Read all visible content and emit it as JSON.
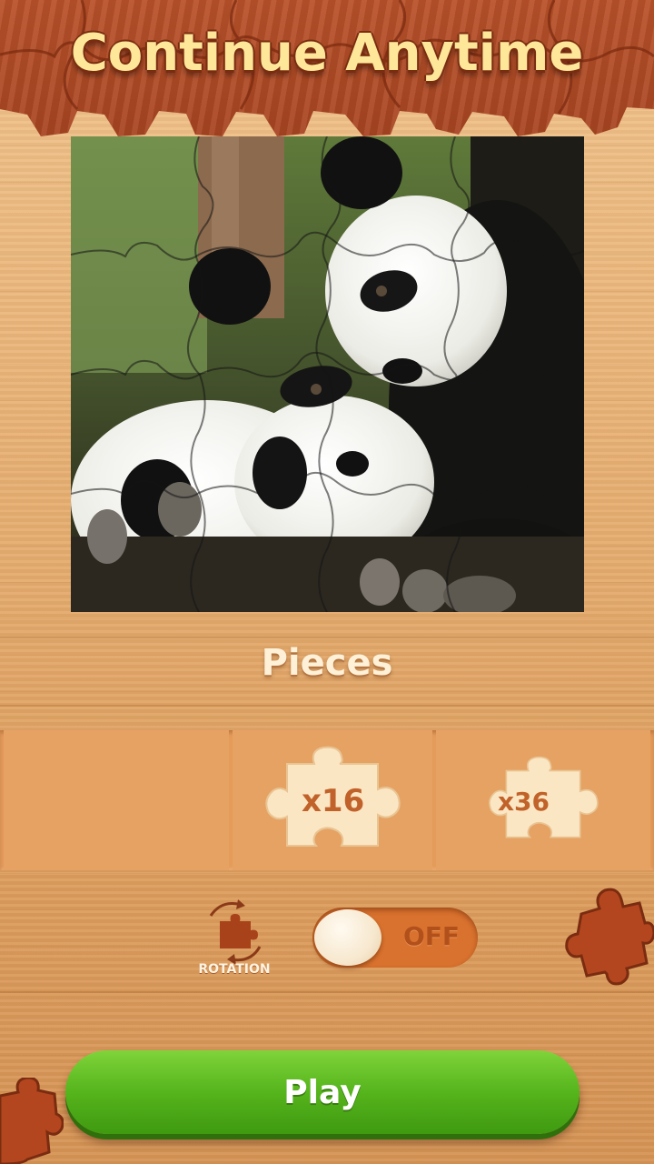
{
  "header": {
    "title": "Continue Anytime"
  },
  "image": {
    "subject": "two-pandas-photo"
  },
  "pieces": {
    "title": "Pieces",
    "options": [
      {
        "label": "",
        "selected": true
      },
      {
        "label": "x16",
        "selected": false
      },
      {
        "label": "x36",
        "selected": false
      }
    ]
  },
  "rotation": {
    "label": "ROTATION",
    "toggle_text": "OFF",
    "enabled": false
  },
  "play": {
    "label": "Play"
  },
  "colors": {
    "wood_dark": "#a84522",
    "title_fill": "#ffe79a",
    "play_green": "#56b41c",
    "toggle_bg": "#d9722e"
  }
}
